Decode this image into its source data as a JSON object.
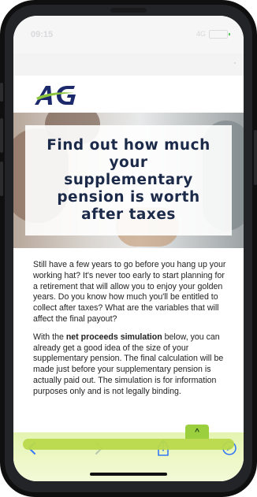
{
  "status_bar": {
    "time": "09:15",
    "signal_text": "4G"
  },
  "brand": {
    "logo_text": "AG",
    "primary_color": "#1c2a6b",
    "accent_color": "#8dc63f"
  },
  "hero": {
    "title": "Find out how much your supplementary pension is worth after taxes"
  },
  "content": {
    "paragraph_1": "Still have a few years to go before you hang up your working hat? It's never too early to start planning for a retirement that will allow you to enjoy your golden years. Do you know how much you'll be entitled to collect after taxes? What are the variables that will affect the final payout?",
    "paragraph_2_prefix": "With the ",
    "paragraph_2_bold": "net proceeds simulation",
    "paragraph_2_suffix": " below, you can already get a good idea of the size of your supplementary pension. The final calculation will be made just before your supplementary pension is actually paid out. The simulation is for information purposes only and is not legally binding."
  },
  "floating": {
    "scroll_top_icon": "chevron-up-icon",
    "scroll_top_glyph": "^"
  },
  "toolbar": {
    "back_icon": "chevron-left-icon",
    "forward_icon": "chevron-right-icon",
    "share_icon": "share-icon",
    "compass_icon": "compass-icon",
    "icon_color": "#3478f6"
  }
}
